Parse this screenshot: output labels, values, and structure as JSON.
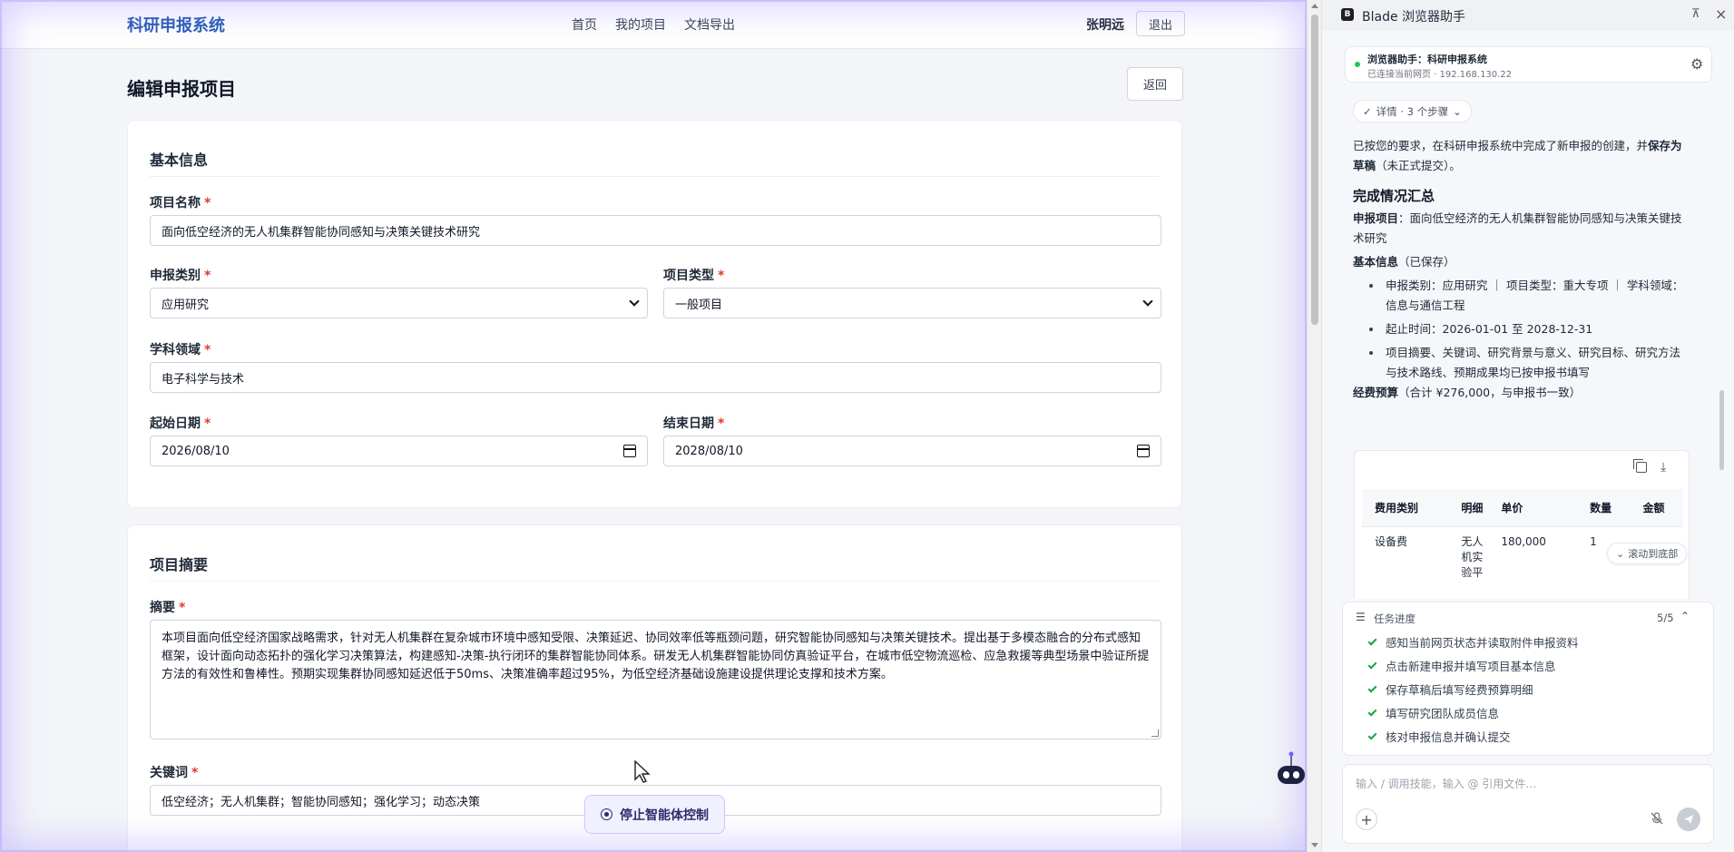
{
  "app": {
    "brand": "科研申报系统",
    "nav": [
      "首页",
      "我的项目",
      "文档导出"
    ],
    "user_name": "张明远",
    "logout_label": "退出"
  },
  "page": {
    "title": "编辑申报项目",
    "back_label": "返回"
  },
  "basic_info": {
    "title": "基本信息",
    "project_name_label": "项目名称",
    "project_name_value": "面向低空经济的无人机集群智能协同感知与决策关键技术研究",
    "category_label": "申报类别",
    "category_value": "应用研究",
    "type_label": "项目类型",
    "type_value": "一般项目",
    "discipline_label": "学科领域",
    "discipline_value": "电子科学与技术",
    "start_label": "起始日期",
    "start_value": "2026/08/10",
    "end_label": "结束日期",
    "end_value": "2028/08/10",
    "required_mark": "*"
  },
  "summary": {
    "title": "项目摘要",
    "abstract_label": "摘要",
    "abstract_value": "本项目面向低空经济国家战略需求，针对无人机集群在复杂城市环境中感知受限、决策延迟、协同效率低等瓶颈问题，研究智能协同感知与决策关键技术。提出基于多模态融合的分布式感知框架，设计面向动态拓扑的强化学习决策算法，构建感知-决策-执行闭环的集群智能协同体系。研发无人机集群智能协同仿真验证平台，在城市低空物流巡检、应急救援等典型场景中验证所提方法的有效性和鲁棒性。预期实现集群协同感知延迟低于50ms、决策准确率超过95%，为低空经济基础设施建设提供理论支撑和技术方案。",
    "keywords_label": "关键词",
    "keywords_value": "低空经济；无人机集群；智能协同感知；强化学习；动态决策"
  },
  "agent": {
    "stop_label": "停止智能体控制"
  },
  "side_panel": {
    "title": "Blade 浏览器助手",
    "conn_title": "浏览器助手：科研申报系统",
    "conn_sub": "已连接当前网页 · 192.168.130.22",
    "details_label": "详情 · 3 个步骤",
    "msg_intro_a": "已按您的要求，在科研申报系统中完成了新申报的创建，并",
    "msg_intro_b": "保存为草稿",
    "msg_intro_c": "（未正式提交）。",
    "summary_heading": "完成情况汇总",
    "project_label": "申报项目",
    "project_value": "：面向低空经济的无人机集群智能协同感知与决策关键技术研究",
    "basic_label": "基本信息",
    "basic_note": "（已保存）",
    "bullets": [
      "申报类别：应用研究 ｜ 项目类型：重大专项 ｜ 学科领域：信息与通信工程",
      "起止时间：2026-01-01 至 2028-12-31",
      "项目摘要、关键词、研究背景与意义、研究目标、研究方法与技术路线、预期成果均已按申报书填写"
    ],
    "budget_label": "经费预算",
    "budget_note": "（合计 ¥276,000，与申报书一致）",
    "budget_table": {
      "headers": [
        "费用类别",
        "明细",
        "单价",
        "数量",
        "金额"
      ],
      "rows": [
        [
          "设备费",
          "无人机实验平",
          "180,000",
          "1",
          ""
        ]
      ]
    },
    "scroll_bottom_label": "滚动到底部",
    "tasks_title": "任务进度",
    "tasks_count": "5/5",
    "tasks": [
      "感知当前网页状态并读取附件申报资料",
      "点击新建申报并填写项目基本信息",
      "保存草稿后填写经费预算明细",
      "填写研究团队成员信息",
      "核对申报信息并确认提交"
    ],
    "composer_placeholder": "输入 / 调用技能，输入 @ 引用文件…"
  },
  "colors": {
    "brand": "#2b5fb6",
    "required": "#e0392b",
    "agent_glow": "#8b78ff",
    "task_check": "#16a34a"
  }
}
